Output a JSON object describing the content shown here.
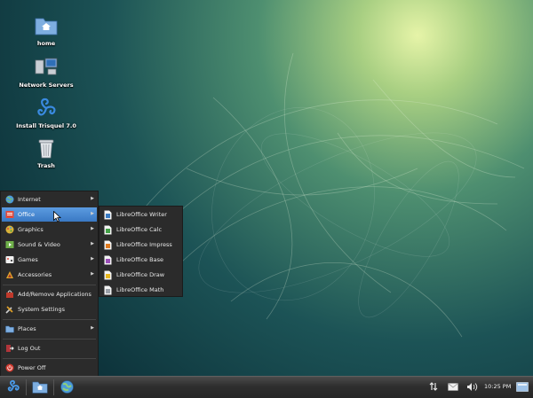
{
  "desktop": {
    "icons": [
      {
        "label": "home",
        "icon": "home-folder-icon"
      },
      {
        "label": "Network Servers",
        "icon": "network-servers-icon"
      },
      {
        "label": "Install Trisquel 7.0",
        "icon": "trisquel-logo-icon"
      },
      {
        "label": "Trash",
        "icon": "trash-icon"
      }
    ]
  },
  "main_menu": {
    "items": [
      {
        "label": "Internet",
        "icon": "globe-icon",
        "submenu": true
      },
      {
        "label": "Office",
        "icon": "office-icon",
        "submenu": true,
        "active": true
      },
      {
        "label": "Graphics",
        "icon": "graphics-icon",
        "submenu": true
      },
      {
        "label": "Sound & Video",
        "icon": "multimedia-icon",
        "submenu": true
      },
      {
        "label": "Games",
        "icon": "games-icon",
        "submenu": true
      },
      {
        "label": "Accessories",
        "icon": "accessories-icon",
        "submenu": true
      },
      {
        "label": "Add/Remove Applications",
        "icon": "software-center-icon"
      },
      {
        "label": "System Settings",
        "icon": "system-settings-icon"
      },
      {
        "label": "Places",
        "icon": "folder-icon",
        "submenu": true
      },
      {
        "label": "Log Out",
        "icon": "logout-icon"
      },
      {
        "label": "Power Off",
        "icon": "power-icon"
      }
    ]
  },
  "office_submenu": {
    "items": [
      {
        "label": "LibreOffice Writer",
        "icon": "writer-icon",
        "color": "#3a7cc4"
      },
      {
        "label": "LibreOffice Calc",
        "icon": "calc-icon",
        "color": "#43a047"
      },
      {
        "label": "LibreOffice Impress",
        "icon": "impress-icon",
        "color": "#e07b20"
      },
      {
        "label": "LibreOffice Base",
        "icon": "base-icon",
        "color": "#9c4fb8"
      },
      {
        "label": "LibreOffice Draw",
        "icon": "draw-icon",
        "color": "#e8b820"
      },
      {
        "label": "LibreOffice Math",
        "icon": "math-icon",
        "color": "#9aa0a8"
      }
    ]
  },
  "taskbar": {
    "launchers": [
      "trisquel-menu-icon",
      "home-folder-icon",
      "web-browser-icon"
    ],
    "tray": [
      "network-transfer-icon",
      "mail-icon",
      "volume-icon",
      "show-desktop-icon"
    ],
    "clock": "10:25 PM"
  },
  "colors": {
    "menu_bg": "#2b2b2b",
    "highlight": "#4a8ad6",
    "taskbar": "#333333"
  }
}
